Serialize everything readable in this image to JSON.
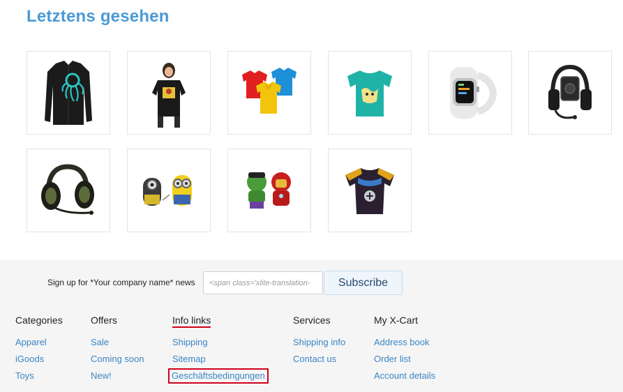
{
  "page": {
    "section_title": "Letztens gesehen"
  },
  "recently_viewed": [
    {
      "name": "octopus-cardigan-thumb",
      "icon": "black-cardigan-with-octopus"
    },
    {
      "name": "woman-tshirt-thumb",
      "icon": "woman-in-black-tshirt"
    },
    {
      "name": "polo-shirts-thumb",
      "icon": "red-yellow-blue-polos"
    },
    {
      "name": "teal-tshirt-thumb",
      "icon": "teal-tshirt"
    },
    {
      "name": "apple-watch-thumb",
      "icon": "white-smartwatch"
    },
    {
      "name": "headset-dark-thumb",
      "icon": "black-gaming-headset"
    },
    {
      "name": "headset-green-thumb",
      "icon": "green-gaming-headset"
    },
    {
      "name": "minion-figures-thumb",
      "icon": "minion-figures"
    },
    {
      "name": "hulk-ironman-thumb",
      "icon": "hulk-ironman-figures"
    },
    {
      "name": "cycling-jersey-thumb",
      "icon": "star-trek-cycling-jersey"
    }
  ],
  "newsletter": {
    "label": "Sign up for *Your company name* news",
    "input_placeholder": "<span class='xlite-translation-",
    "button_label": "Subscribe"
  },
  "footer": {
    "columns": [
      {
        "title": "Categories",
        "links": [
          "Apparel",
          "iGoods",
          "Toys"
        ]
      },
      {
        "title": "Offers",
        "links": [
          "Sale",
          "Coming soon",
          "New!"
        ]
      },
      {
        "title": "Info links",
        "links": [
          "Shipping",
          "Sitemap",
          "Geschäftsbedingungen"
        ]
      },
      {
        "title": "Services",
        "links": [
          "Shipping info",
          "Contact us"
        ]
      },
      {
        "title": "My X-Cart",
        "links": [
          "Address book",
          "Order list",
          "Account details"
        ]
      }
    ]
  },
  "colors": {
    "title_blue": "#4a9ad4",
    "link_blue": "#3a85c4",
    "highlight_red": "#d0021b",
    "footer_bg": "#f5f5f5"
  }
}
